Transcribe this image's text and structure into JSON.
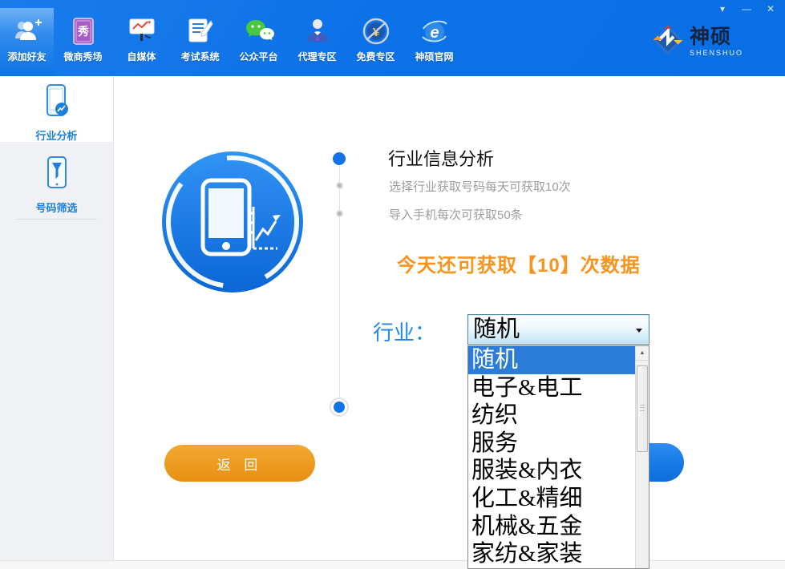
{
  "window": {
    "controls": {
      "menu": "▾",
      "minimize": "—",
      "close": "✕"
    }
  },
  "topbar": {
    "tabs": [
      {
        "label": "添加好友"
      },
      {
        "label": "微商秀场",
        "icon_char": "秀"
      },
      {
        "label": "自媒体"
      },
      {
        "label": "考试系统"
      },
      {
        "label": "公众平台"
      },
      {
        "label": "代理专区"
      },
      {
        "label": "免费专区",
        "icon_char": "¥"
      },
      {
        "label": "神硕官网",
        "icon_char": "e"
      }
    ],
    "logo": {
      "title": "神硕",
      "subtitle": "SHENSHUO"
    }
  },
  "sidebar": {
    "items": [
      {
        "label": "行业分析"
      },
      {
        "label": "号码筛选"
      }
    ]
  },
  "main": {
    "steps": {
      "title": "行业信息分析",
      "items": [
        "选择行业获取号码每天可获取10次",
        "导入手机每次可获取50条"
      ]
    },
    "quota": "今天还可获取【10】次数据",
    "industry": {
      "label": "行业：",
      "selected": "随机",
      "selected_index": 0,
      "options": [
        "随机",
        "电子&电工",
        "纺织",
        "服务",
        "服装&内衣",
        "化工&精细",
        "机械&五金",
        "家纺&家装"
      ]
    },
    "buttons": {
      "back": "返 回"
    }
  },
  "icons": {
    "scroll_up": "▲"
  },
  "colors": {
    "accent_orange": "#F7941E",
    "primary_blue": "#0B71E8",
    "selection_blue": "#2A7CD8"
  }
}
